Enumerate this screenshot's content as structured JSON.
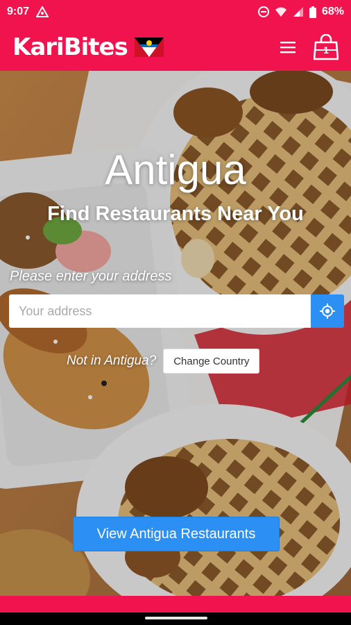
{
  "status_bar": {
    "time": "9:07",
    "battery": "68%",
    "icons": [
      "notification-triangle-icon",
      "do-not-disturb-icon",
      "wifi-icon",
      "signal-icon",
      "battery-icon"
    ]
  },
  "header": {
    "brand": "KariBites",
    "flag_icon": "antigua-flag-icon",
    "menu_icon": "hamburger-menu-icon",
    "cart_icon": "shopping-bag-icon",
    "cart_count": "1"
  },
  "hero": {
    "title": "Antigua",
    "subtitle": "Find Restaurants Near You",
    "address_label": "Please enter your address",
    "address_placeholder": "Your address",
    "locate_icon": "locate-crosshair-icon",
    "not_in_text": "Not in Antigua?",
    "change_country_label": "Change Country",
    "view_button_label": "View Antigua Restaurants"
  },
  "colors": {
    "brand_red": "#f0134e",
    "accent_blue": "#2b8ff3"
  }
}
